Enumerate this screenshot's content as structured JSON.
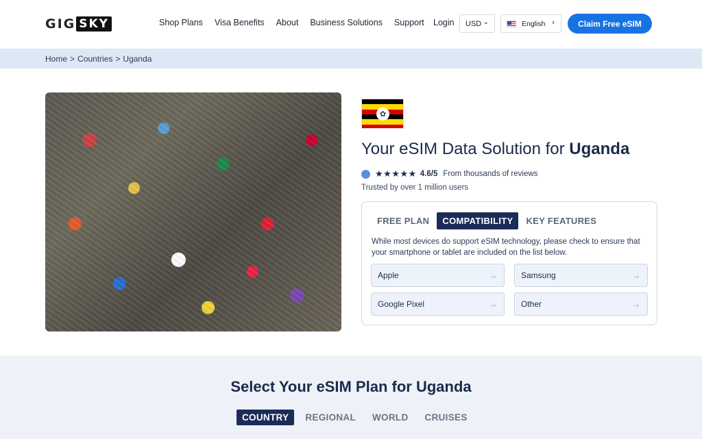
{
  "header": {
    "logo_left": "GIG",
    "logo_right": "SKY",
    "nav": [
      "Shop Plans",
      "Visa Benefits",
      "About",
      "Business Solutions",
      "Support"
    ],
    "login": "Login",
    "currency": "USD",
    "language": "English",
    "cta": "Claim Free eSIM"
  },
  "breadcrumb": [
    "Home",
    ">",
    "Countries",
    ">",
    "Uganda"
  ],
  "hero": {
    "title_prefix": "Your eSIM Data Solution for ",
    "country": "Uganda",
    "stars": "★★★★★",
    "score": "4.6/5",
    "reviews": "From thousands of reviews",
    "trusted": "Trusted by over 1 million users",
    "flag_colors": [
      "#000000",
      "#fcdc04",
      "#d90000",
      "#000000",
      "#fcdc04",
      "#d90000"
    ]
  },
  "card": {
    "tabs": [
      "FREE PLAN",
      "COMPATIBILITY",
      "KEY FEATURES"
    ],
    "active_tab": "COMPATIBILITY",
    "description": "While most devices do support eSIM technology, please check to ensure that your smartphone or tablet are included on the list below.",
    "devices": [
      "Apple",
      "Samsung",
      "Google Pixel",
      "Other"
    ],
    "arrow": "→"
  },
  "plans": {
    "title_prefix": "Select Your eSIM Plan for ",
    "country": "Uganda",
    "tabs": [
      "COUNTRY",
      "REGIONAL",
      "WORLD",
      "CRUISES"
    ],
    "active_tab": "COUNTRY"
  },
  "colors": {
    "primary": "#1673e4",
    "navy": "#1b2c59",
    "breadcrumb_bg": "#dde8f7"
  }
}
